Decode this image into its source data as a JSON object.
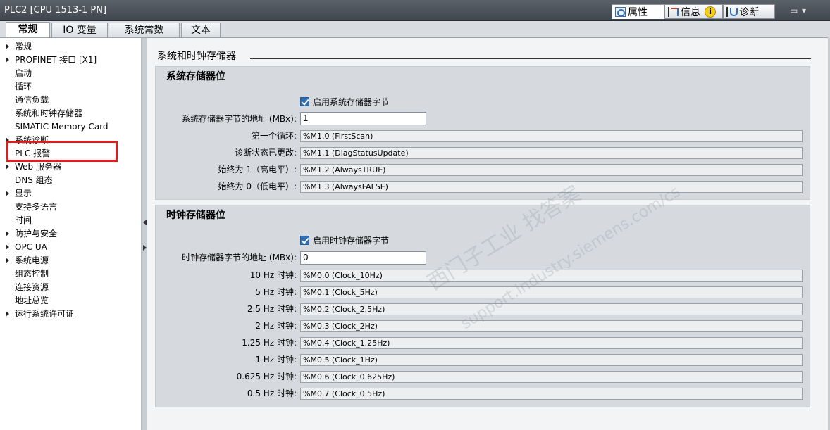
{
  "window": {
    "title": "PLC2 [CPU 1513-1 PN]"
  },
  "panel_tabs": [
    {
      "label": "属性",
      "icon": "properties-icon"
    },
    {
      "label": "信息",
      "icon": "info-icon"
    },
    {
      "label": "诊断",
      "icon": "diagnostics-icon"
    }
  ],
  "warning_badge": "i",
  "window_controls": {
    "restore": "▭",
    "menu": "▾"
  },
  "tabs": [
    {
      "label": "常规"
    },
    {
      "label": "IO 变量"
    },
    {
      "label": "系统常数"
    },
    {
      "label": "文本"
    }
  ],
  "nav": [
    {
      "label": "常规",
      "expandable": true
    },
    {
      "label": "PROFINET 接口 [X1]",
      "expandable": true
    },
    {
      "label": "启动",
      "expandable": false
    },
    {
      "label": "循环",
      "expandable": false
    },
    {
      "label": "通信负载",
      "expandable": false
    },
    {
      "label": "系统和时钟存储器",
      "expandable": false
    },
    {
      "label": "SIMATIC Memory Card",
      "expandable": false
    },
    {
      "label": "系统诊断",
      "expandable": true
    },
    {
      "label": "PLC 报警",
      "expandable": false
    },
    {
      "label": "Web 服务器",
      "expandable": true
    },
    {
      "label": "DNS 组态",
      "expandable": false
    },
    {
      "label": "显示",
      "expandable": true
    },
    {
      "label": "支持多语言",
      "expandable": false
    },
    {
      "label": "时间",
      "expandable": false
    },
    {
      "label": "防护与安全",
      "expandable": true
    },
    {
      "label": "OPC UA",
      "expandable": true
    },
    {
      "label": "系统电源",
      "expandable": true
    },
    {
      "label": "组态控制",
      "expandable": false
    },
    {
      "label": "连接资源",
      "expandable": false
    },
    {
      "label": "地址总览",
      "expandable": false
    },
    {
      "label": "运行系统许可证",
      "expandable": true
    }
  ],
  "section_title": "系统和时钟存储器",
  "system_memory": {
    "title": "系统存储器位",
    "enable_label": "启用系统存储器字节",
    "address_label": "系统存储器字节的地址 (MBx):",
    "address_value": "1",
    "bits": [
      {
        "label": "第一个循环:",
        "value": "%M1.0 (FirstScan)"
      },
      {
        "label": "诊断状态已更改:",
        "value": "%M1.1 (DiagStatusUpdate)"
      },
      {
        "label": "始终为 1（高电平）:",
        "value": "%M1.2 (AlwaysTRUE)"
      },
      {
        "label": "始终为 0（低电平）:",
        "value": "%M1.3 (AlwaysFALSE)"
      }
    ]
  },
  "clock_memory": {
    "title": "时钟存储器位",
    "enable_label": "启用时钟存储器字节",
    "address_label": "时钟存储器字节的地址 (MBx):",
    "address_value": "0",
    "bits": [
      {
        "label": "10 Hz 时钟:",
        "value": "%M0.0 (Clock_10Hz)"
      },
      {
        "label": "5 Hz 时钟:",
        "value": "%M0.1 (Clock_5Hz)"
      },
      {
        "label": "2.5 Hz 时钟:",
        "value": "%M0.2 (Clock_2.5Hz)"
      },
      {
        "label": "2 Hz 时钟:",
        "value": "%M0.3 (Clock_2Hz)"
      },
      {
        "label": "1.25 Hz 时钟:",
        "value": "%M0.4 (Clock_1.25Hz)"
      },
      {
        "label": "1 Hz 时钟:",
        "value": "%M0.5 (Clock_1Hz)"
      },
      {
        "label": "0.625 Hz 时钟:",
        "value": "%M0.6 (Clock_0.625Hz)"
      },
      {
        "label": "0.5 Hz 时钟:",
        "value": "%M0.7 (Clock_0.5Hz)"
      }
    ]
  },
  "watermark": {
    "line1": "西门子工业   找答案",
    "line2": "support.industry.siemens.com/cs"
  },
  "colors": {
    "highlight_box": "#e01d1d",
    "checkbox": "#2f6fb3",
    "titlebar": "#4a5158"
  }
}
